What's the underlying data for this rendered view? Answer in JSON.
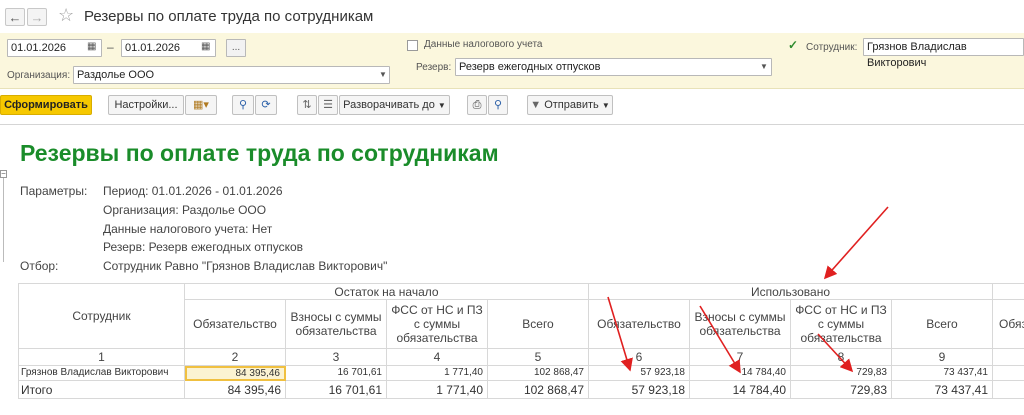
{
  "window": {
    "title": "Резервы по оплате труда по сотрудникам"
  },
  "icons": {
    "back": "arrow-left-icon",
    "forward": "arrow-right-icon",
    "favorite": "star-icon",
    "calendar": "calendar-icon"
  },
  "filters": {
    "date_from": "01.01.2026",
    "date_to": "01.01.2026",
    "dash": "–",
    "more": "...",
    "tax_data_label": "Данные налогового учета",
    "tax_data_checked": false,
    "organization_label": "Организация:",
    "organization_value": "Раздолье ООО",
    "reserve_label": "Резерв:",
    "reserve_value": "Резерв ежегодных отпусков",
    "employee_label": "Сотрудник:",
    "employee_checked": true,
    "employee_value": "Грязнов Владислав Викторович"
  },
  "toolbar": {
    "generate": "Сформировать",
    "settings": "Настройки...",
    "expand": "Разворачивать до",
    "send": "Отправить"
  },
  "report": {
    "title": "Резервы по оплате труда по сотрудникам",
    "params": [
      {
        "label": "Параметры:",
        "value": "Период: 01.01.2026 - 01.01.2026"
      },
      {
        "label": "",
        "value": "Организация: Раздолье ООО"
      },
      {
        "label": "",
        "value": "Данные налогового учета: Нет"
      },
      {
        "label": "",
        "value": "Резерв: Резерв ежегодных отпусков"
      },
      {
        "label": "Отбор:",
        "value": "Сотрудник Равно \"Грязнов Владислав Викторович\""
      }
    ],
    "table": {
      "employee_header": "Сотрудник",
      "group_opening": "Остаток на начало",
      "group_used": "Использовано",
      "columns": [
        "Обязательство",
        "Взносы с суммы обязательства",
        "ФСС от НС и ПЗ с суммы обязательства",
        "Всего",
        "Обязательство",
        "Взносы с суммы обязательства",
        "ФСС от НС и ПЗ с суммы обязательства",
        "Всего",
        "Обяза"
      ],
      "numbers": [
        "1",
        "2",
        "3",
        "4",
        "5",
        "6",
        "7",
        "8",
        "9"
      ],
      "row": {
        "name": "Грязнов Владислав Викторович",
        "values": [
          "84 395,46",
          "16 701,61",
          "1 771,40",
          "102 868,47",
          "57 923,18",
          "14 784,40",
          "729,83",
          "73 437,41"
        ]
      },
      "total": {
        "name": "Итого",
        "values": [
          "84 395,46",
          "16 701,61",
          "1 771,40",
          "102 868,47",
          "57 923,18",
          "14 784,40",
          "729,83",
          "73 437,41"
        ]
      }
    }
  }
}
